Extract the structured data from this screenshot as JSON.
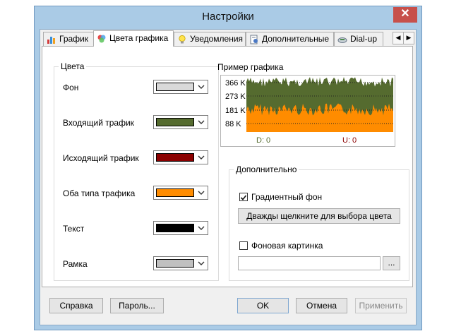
{
  "window": {
    "title": "Настройки",
    "close_label": "✕"
  },
  "tabs": [
    {
      "label": "График",
      "icon": "bar-chart-icon"
    },
    {
      "label": "Цвета графика",
      "icon": "palette-icon",
      "active": true
    },
    {
      "label": "Уведомления",
      "icon": "lightbulb-icon"
    },
    {
      "label": "Дополнительные",
      "icon": "settings-page-icon"
    },
    {
      "label": "Dial-up",
      "icon": "modem-icon"
    }
  ],
  "tab_scroll": {
    "left": "◀",
    "right": "▶"
  },
  "colors_group": {
    "title": "Цвета",
    "items": [
      {
        "label": "Фон",
        "color": "#d9d9d9"
      },
      {
        "label": "Входящий трафик",
        "color": "#556b2f"
      },
      {
        "label": "Исходящий трафик",
        "color": "#8b0000"
      },
      {
        "label": "Оба типа трафика",
        "color": "#ff8c00"
      },
      {
        "label": "Текст",
        "color": "#000000"
      },
      {
        "label": "Рамка",
        "color": "#c0c0c0"
      }
    ]
  },
  "preview": {
    "title": "Пример графика",
    "y_labels": [
      "366 K",
      "273 K",
      "181 K",
      "88 K"
    ],
    "download": "D: 0",
    "upload": "U: 0",
    "incoming_color": "#556b2f",
    "both_color": "#ff8c00"
  },
  "extra_group": {
    "title": "Дополнительно",
    "gradient_label": "Градиентный фон",
    "gradient_checked": true,
    "pick_color_button": "Дважды щелкните для выбора цвета",
    "background_image_label": "Фоновая картинка",
    "background_image_checked": false,
    "path_value": "",
    "browse_button": "..."
  },
  "footer": {
    "help": "Справка",
    "password": "Пароль...",
    "ok": "OK",
    "cancel": "Отмена",
    "apply": "Применить"
  }
}
